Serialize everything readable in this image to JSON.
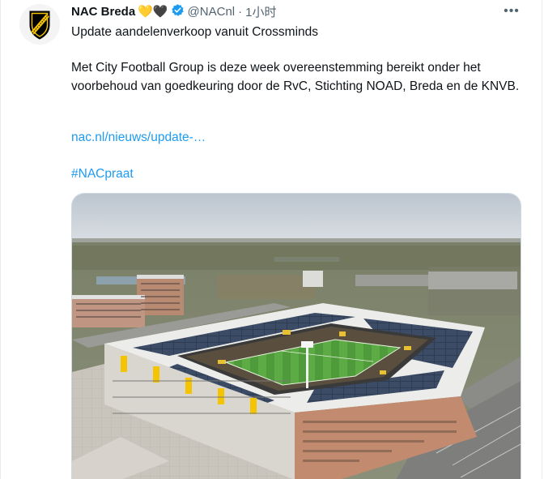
{
  "tweet": {
    "display_name": "NAC Breda",
    "emojis": "💛🖤",
    "handle": "@NACnl",
    "separator": "·",
    "time": "1小时",
    "line1": "Update aandelenverkoop vanuit Crossminds",
    "paragraph": "Met City Football Group is deze week overeenstemming bereikt onder het voorbehoud van goedkeuring door de RvC, Stichting NOAD,  Breda en de KNVB.",
    "link": "nac.nl/nieuws/update-…",
    "hashtag": "#NACpraat",
    "more_label": "•••"
  },
  "icons": {
    "avatar": "nac-breda-crest-icon",
    "verified": "verified-badge-icon",
    "more": "more-options-icon"
  },
  "colors": {
    "link": "#1d9bf0",
    "verified": "#1d9bf0",
    "nac_yellow": "#f5c400",
    "text": "#0f1419",
    "muted": "#536471"
  }
}
